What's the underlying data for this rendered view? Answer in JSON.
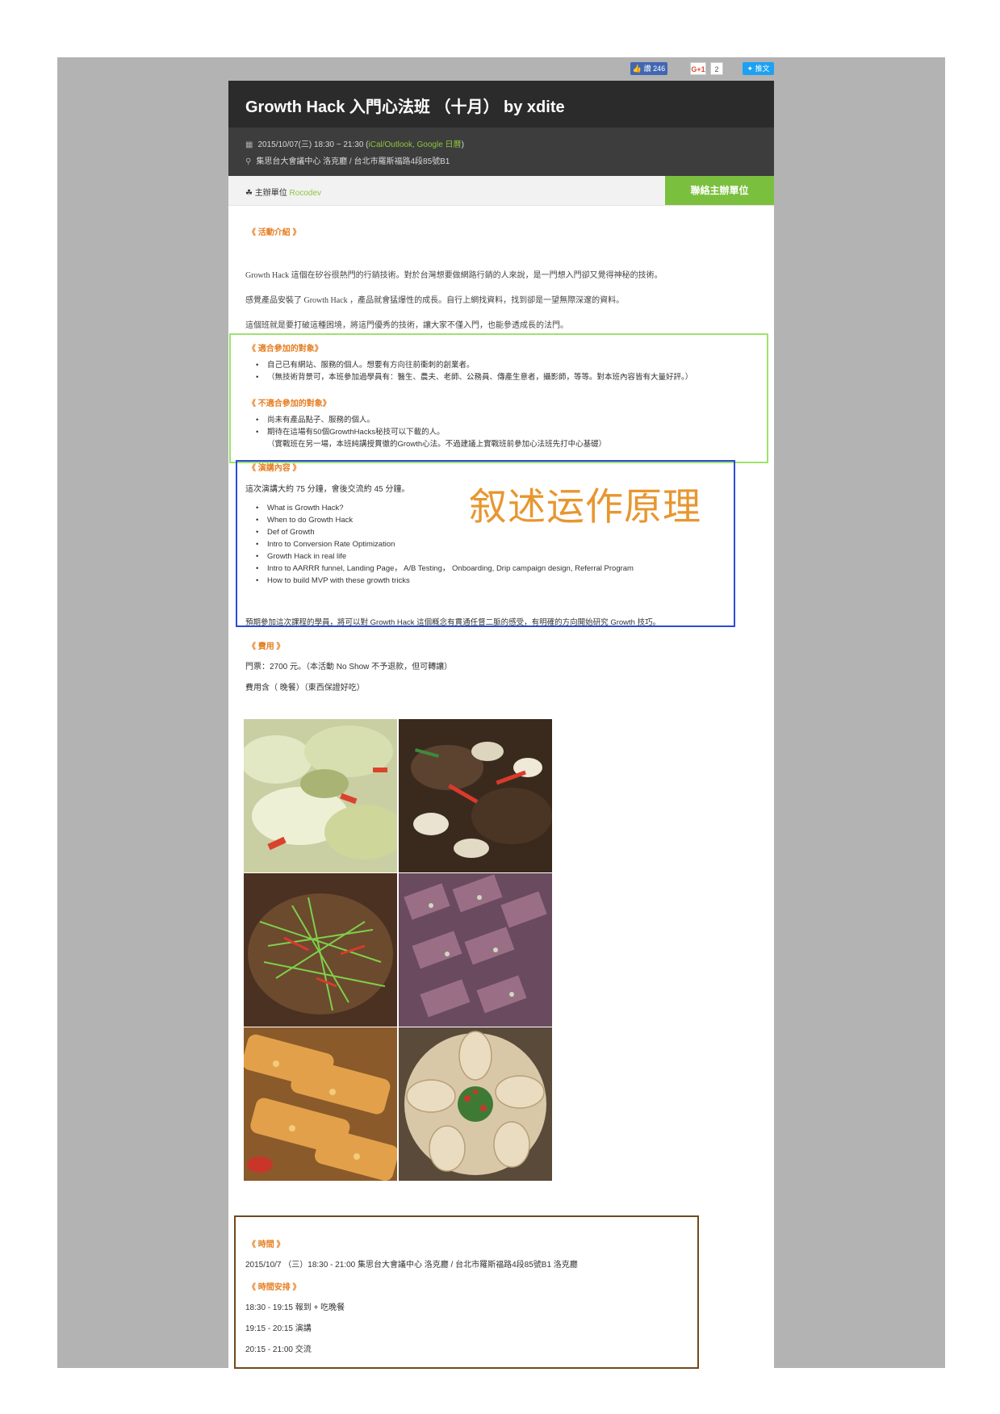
{
  "social": {
    "like_label": "讚 246",
    "gplus_label": "G+1",
    "gplus_count": "2",
    "tweet_label": "推文"
  },
  "event": {
    "title": "Growth Hack 入門心法班 （十月） by xdite",
    "datetime": "2015/10/07(三) 18:30 ~ 21:30 (",
    "calendar_links": "iCal/Outlook, Google 日曆",
    "datetime_close": ")",
    "location": "集思台大會議中心 洛克廳 / 台北市羅斯福路4段85號B1"
  },
  "organizer": {
    "label": "主辦單位",
    "name": "Rocodev",
    "contact_button": "聯絡主辦單位"
  },
  "intro": {
    "heading": "《 活動介紹 》",
    "paragraphs": [
      "Growth Hack 這個在矽谷很熱門的行銷技術。對於台灣想要做網路行銷的人來說，是一門想入門卻又覺得神秘的技術。",
      "感覺產品安裝了 Growth Hack ，產品就會猛爆性的成長。自行上網找資料，找到卻是一望無際深邃的資料。",
      "這個班就是要打破這種困境，將這門優秀的技術，讓大家不僅入門，也能參透成長的法門。"
    ]
  },
  "suitable": {
    "heading": "《 適合參加的對象》",
    "items": [
      "自己已有網站、服務的個人。想要有方向往前衝刺的創業者。",
      "（無技術背景可，本班參加過學員有：醫生、農夫、老師、公務員、傳產生意者，攝影師，等等。對本班內容皆有大量好評。）"
    ]
  },
  "unsuitable": {
    "heading": "《 不適合參加的對象》",
    "items": [
      "尚未有產品點子、服務的個人。",
      "期待在這場有50個GrowthHacks秘技可以下載的人。"
    ],
    "note": "（實戰班在另一場，本班純講授貫徹的Growth心法。不過建議上實戰班前參加心法班先打中心基礎）"
  },
  "talk": {
    "heading": "《 演講內容 》",
    "intro": "這次演講大約 75 分鐘，會後交流約 45 分鐘。",
    "items": [
      "What is Growth Hack?",
      "When to do Growth Hack",
      "Def of Growth",
      "Intro to Conversion Rate Optimization",
      "Growth Hack in real life",
      "Intro to AARRR funnel, Landing Page， A/B Testing， Onboarding, Drip campaign design, Referral Program",
      "How to build MVP with these growth tricks"
    ],
    "outcome": "預期參加這次課程的學員，將可以對 Growth Hack 這個概念有貫通任督二脈的感受，有明確的方向開始研究 Growth 技巧。"
  },
  "annotation": "叙述运作原理",
  "fee": {
    "heading": "《 費用 》",
    "ticket": "門票：2700 元。（本活動 No Show 不予退款，但可轉讓）",
    "includes": "費用含（ 晚餐）（東西保證好吃）"
  },
  "schedule": {
    "time_heading": "《 時間 》",
    "time_text": "2015/10/7 （三）18:30 - 21:00  集思台大會議中心 洛克廳 / 台北市羅斯福路4段85號B1 洛克廳",
    "agenda_heading": "《 時間安排 》",
    "agenda": [
      "18:30 - 19:15 報到 + 吃晚餐",
      "19:15 - 20:15 演講",
      "20:15 - 21:00 交流"
    ]
  },
  "colors": {
    "accent_orange": "#e67e22",
    "accent_green": "#7bbf3e",
    "header_dark": "#2b2b2b",
    "annotation_orange": "#e8962f"
  }
}
